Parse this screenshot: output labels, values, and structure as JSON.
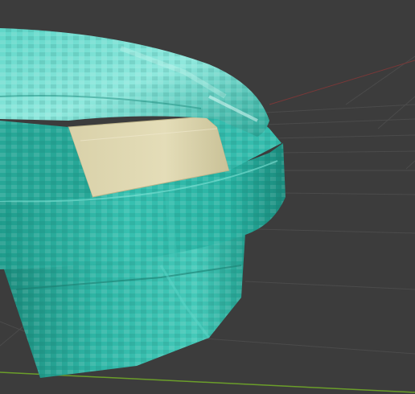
{
  "viewport": {
    "kind": "3d-viewport",
    "background_color": "#3c3c3c",
    "grid_line_color": "#4a4a4a",
    "x_axis_color": "#8a3a3a",
    "y_axis_color": "#6a9a2a",
    "grid_visible": true
  },
  "object": {
    "kind": "mesh",
    "base_color": "#2fb3a4",
    "highlight_color": "#7fe6dc",
    "shadow_color": "#17806f",
    "inner_panel_color": "#d8d0a8"
  }
}
